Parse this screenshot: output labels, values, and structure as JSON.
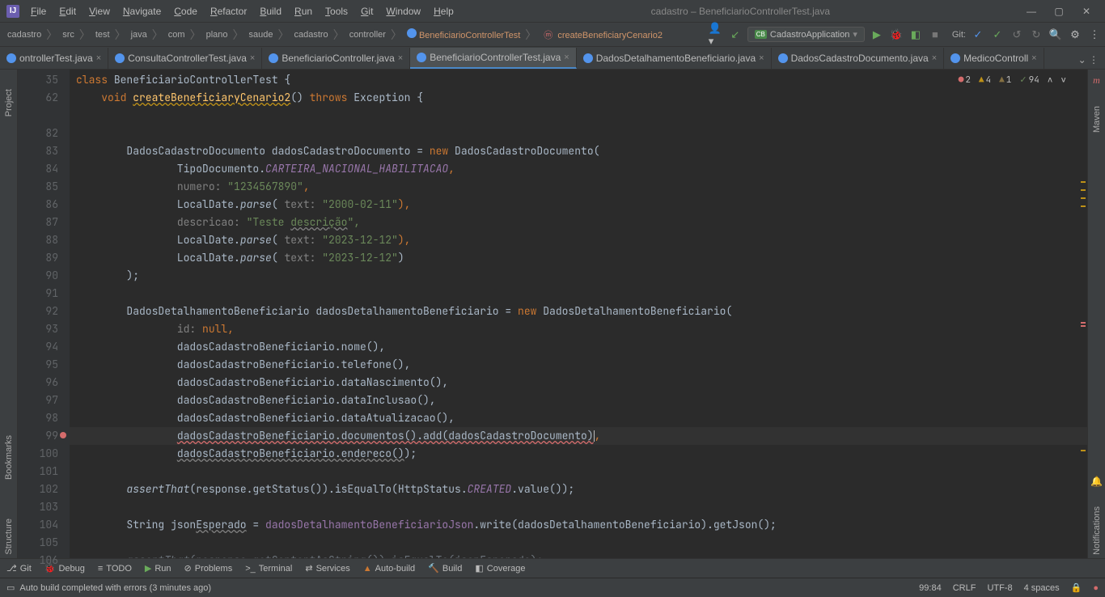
{
  "app": {
    "title": "cadastro – BeneficiarioControllerTest.java"
  },
  "menu": [
    "File",
    "Edit",
    "View",
    "Navigate",
    "Code",
    "Refactor",
    "Build",
    "Run",
    "Tools",
    "Git",
    "Window",
    "Help"
  ],
  "breadcrumb": [
    "cadastro",
    "src",
    "test",
    "java",
    "com",
    "plano",
    "saude",
    "cadastro",
    "controller",
    "BeneficiarioControllerTest",
    "createBeneficiaryCenario2"
  ],
  "runConfig": "CadastroApplication",
  "gitLabel": "Git:",
  "tabs": [
    {
      "label": "ontrollerTest.java",
      "active": false
    },
    {
      "label": "ConsultaControllerTest.java",
      "active": false
    },
    {
      "label": "BeneficiarioController.java",
      "active": false
    },
    {
      "label": "BeneficiarioControllerTest.java",
      "active": true
    },
    {
      "label": "DadosDetalhamentoBeneficiario.java",
      "active": false
    },
    {
      "label": "DadosCadastroDocumento.java",
      "active": false
    },
    {
      "label": "MedicoControll",
      "active": false
    }
  ],
  "inspection": {
    "errors": "2",
    "warnings": "4",
    "weak": "1",
    "typos": "94"
  },
  "lineNumbers": [
    "35",
    "62",
    "",
    "82",
    "83",
    "84",
    "85",
    "86",
    "87",
    "88",
    "89",
    "90",
    "91",
    "92",
    "93",
    "94",
    "95",
    "96",
    "97",
    "98",
    "99",
    "100",
    "101",
    "102",
    "103",
    "104",
    "105",
    "106"
  ],
  "code": {
    "l0": "class ",
    "l0b": "BeneficiarioControllerTest",
    "l0c": " {",
    "l1a": "    void ",
    "l1b": "createBeneficiaryCenario2",
    "l1c": "() ",
    "l1d": "throws",
    "l1e": " Exception {",
    "l3a": "        DadosCadastroDocumento dadosCadastroDocumento = ",
    "l3b": "new",
    "l3c": " DadosCadastroDocumento(",
    "l4a": "                TipoDocumento.",
    "l4b": "CARTEIRA_NACIONAL_HABILITACAO",
    "l4c": ",",
    "l5a": "                ",
    "l5b": "numero:",
    "l5c": " \"1234567890\"",
    "l5d": ",",
    "l6a": "                LocalDate.",
    "l6b": "parse",
    "l6c": "( ",
    "l6d": "text:",
    "l6e": " \"2000-02-11\"",
    "l6f": "),",
    "l7a": "                ",
    "l7b": "descricao:",
    "l7c": " \"Teste ",
    "l7d": "descrição",
    "l7e": "\",",
    "l8a": "                LocalDate.",
    "l8b": "parse",
    "l8c": "( ",
    "l8d": "text:",
    "l8e": " \"2023-12-12\"",
    "l8f": "),",
    "l9a": "                LocalDate.",
    "l9b": "parse",
    "l9c": "( ",
    "l9d": "text:",
    "l9e": " \"2023-12-12\"",
    "l9f": ")",
    "l10": "        );",
    "l12a": "        DadosDetalhamentoBeneficiario dadosDetalhamentoBeneficiario = ",
    "l12b": "new",
    "l12c": " DadosDetalhamentoBeneficiario(",
    "l13a": "                ",
    "l13b": "id:",
    "l13c": " null",
    "l13d": ",",
    "l14": "                dadosCadastroBeneficiario.nome(),",
    "l15": "                dadosCadastroBeneficiario.telefone(),",
    "l16": "                dadosCadastroBeneficiario.dataNascimento(),",
    "l17": "                dadosCadastroBeneficiario.dataInclusao(),",
    "l18": "                dadosCadastroBeneficiario.dataAtualizacao(),",
    "l19a": "                ",
    "l19b": "dadosCadastroBeneficiario.documentos().add(dadosCadastroDocumento)",
    "l19c": ",",
    "l20a": "                ",
    "l20b": "dadosCadastroBeneficiario.endereco()",
    "l20c": ");",
    "l22a": "        ",
    "l22b": "assertThat",
    "l22c": "(response.getStatus()).isEqualTo(HttpStatus.",
    "l22d": "CREATED",
    "l22e": ".value());",
    "l24a": "        String json",
    "l24b": "Esperado",
    "l24c": " = ",
    "l24d": "dadosDetalhamentoBeneficiarioJson",
    "l24e": ".write(dadosDetalhamentoBeneficiario).getJson();",
    "l26a": "        ",
    "l26b": "assertThat",
    "l26c": "(response.getContentAsString()).isEqualTo(json",
    "l26d": "Esperado",
    "l26e": ");"
  },
  "leftTools": [
    "Project",
    "Bookmarks",
    "Structure"
  ],
  "rightTools": [
    "Maven",
    "Notifications"
  ],
  "rightIcon": "m",
  "bottomTools": [
    {
      "icon": "⎇",
      "label": "Git"
    },
    {
      "icon": "🐞",
      "label": "Debug"
    },
    {
      "icon": "≡",
      "label": "TODO"
    },
    {
      "icon": "▶",
      "label": "Run"
    },
    {
      "icon": "⊘",
      "label": "Problems"
    },
    {
      "icon": ">_",
      "label": "Terminal"
    },
    {
      "icon": "⇄",
      "label": "Services"
    },
    {
      "icon": "▲",
      "label": "Auto-build"
    },
    {
      "icon": "🔨",
      "label": "Build"
    },
    {
      "icon": "◧",
      "label": "Coverage"
    }
  ],
  "status": {
    "message": "Auto build completed with errors (3 minutes ago)",
    "pos": "99:84",
    "eol": "CRLF",
    "enc": "UTF-8",
    "indent": "4 spaces"
  }
}
